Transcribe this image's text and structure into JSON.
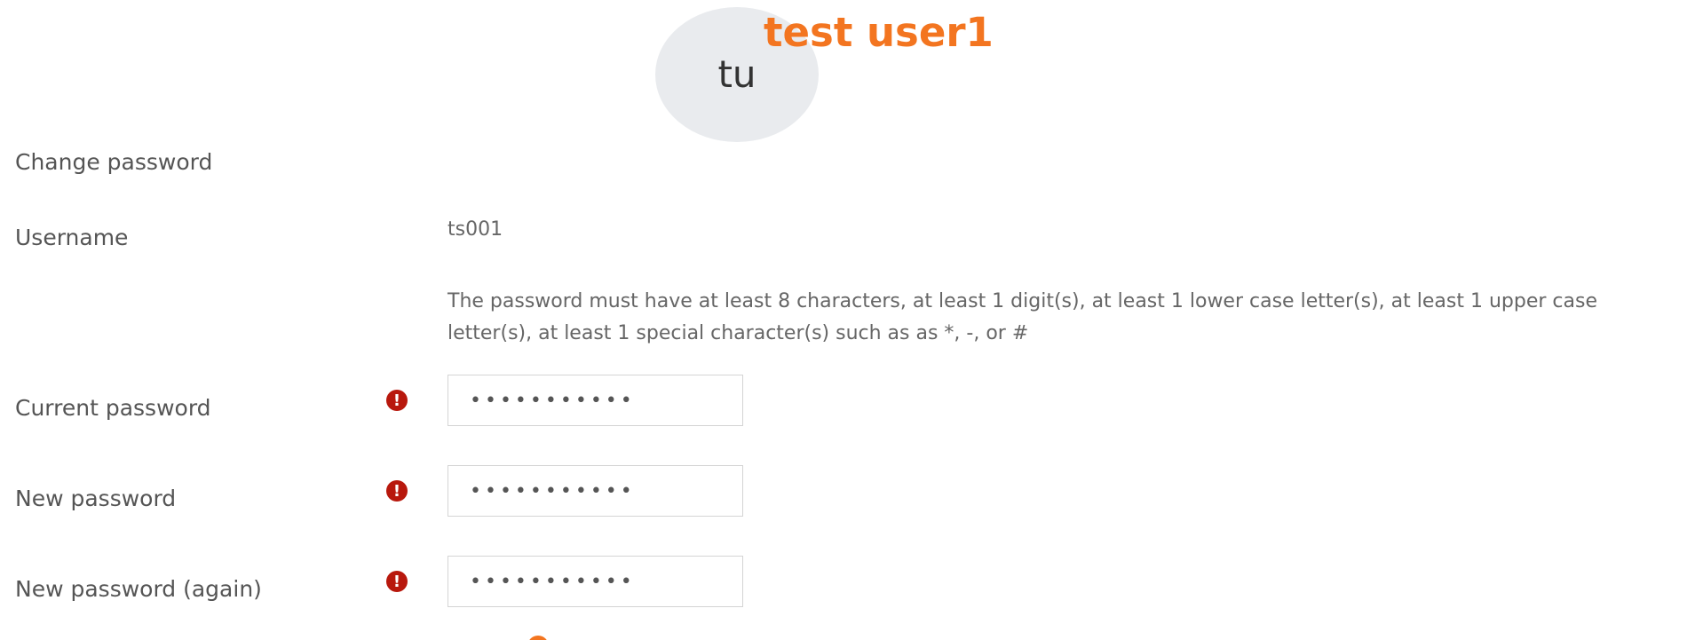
{
  "profile": {
    "initials": "tu",
    "name": "test user1"
  },
  "form": {
    "title": "Change password",
    "username_label": "Username",
    "username_value": "ts001",
    "password_policy": "The password must have at least 8 characters, at least 1 digit(s), at least 1 lower case letter(s), at least 1 upper case letter(s), at least 1 special character(s) such as as *, -, or #",
    "fields": [
      {
        "label": "Current password",
        "masked_value": "•••••••••••"
      },
      {
        "label": "New password",
        "masked_value": "•••••••••••"
      },
      {
        "label": "New password (again)",
        "masked_value": "•••••••••••"
      }
    ],
    "required_icon": "exclamation-circle-icon"
  },
  "colors": {
    "accent": "#f37520",
    "required": "#b8180d",
    "avatar_bg": "#e9ebee"
  }
}
